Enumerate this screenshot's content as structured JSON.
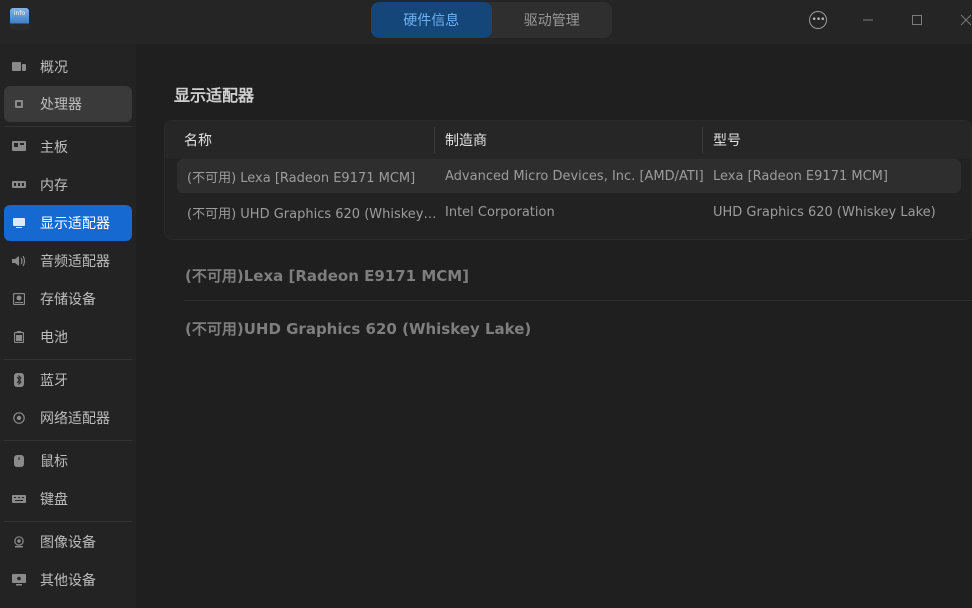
{
  "window": {
    "logo_text": "info",
    "tabs": [
      {
        "label": "硬件信息",
        "active": true
      },
      {
        "label": "驱动管理",
        "active": false
      }
    ],
    "controls": {
      "menu": "•••",
      "minimize": "—",
      "maximize": "□",
      "close": "✕"
    }
  },
  "sidebar": {
    "items": [
      {
        "label": "概况",
        "icon": "overview-icon"
      },
      {
        "label": "处理器",
        "icon": "cpu-icon"
      },
      {
        "label": "主板",
        "icon": "motherboard-icon"
      },
      {
        "label": "内存",
        "icon": "memory-icon"
      },
      {
        "label": "显示适配器",
        "icon": "display-adapter-icon"
      },
      {
        "label": "音频适配器",
        "icon": "audio-icon"
      },
      {
        "label": "存储设备",
        "icon": "storage-icon"
      },
      {
        "label": "电池",
        "icon": "battery-icon"
      },
      {
        "label": "蓝牙",
        "icon": "bluetooth-icon"
      },
      {
        "label": "网络适配器",
        "icon": "network-icon"
      },
      {
        "label": "鼠标",
        "icon": "mouse-icon"
      },
      {
        "label": "键盘",
        "icon": "keyboard-icon"
      },
      {
        "label": "图像设备",
        "icon": "camera-icon"
      },
      {
        "label": "其他设备",
        "icon": "other-devices-icon"
      }
    ],
    "selected": "显示适配器",
    "hovered": "处理器"
  },
  "main": {
    "title": "显示适配器",
    "table": {
      "headers": [
        "名称",
        "制造商",
        "型号"
      ],
      "rows": [
        [
          "(不可用) Lexa [Radeon E9171 MCM]",
          "Advanced Micro Devices, Inc. [AMD/ATI]",
          "Lexa [Radeon E9171 MCM]"
        ],
        [
          "(不可用) UHD Graphics 620 (Whiskey…",
          "Intel Corporation",
          "UHD Graphics 620 (Whiskey Lake)"
        ]
      ]
    },
    "details": [
      "(不可用)Lexa [Radeon E9171 MCM]",
      "(不可用)UHD Graphics 620 (Whiskey Lake)"
    ]
  },
  "colors": {
    "accent": "#1769d2",
    "tab_active_bg": "#14467a",
    "tab_active_text": "#6fb0ee",
    "background": "#1f1f1f"
  }
}
